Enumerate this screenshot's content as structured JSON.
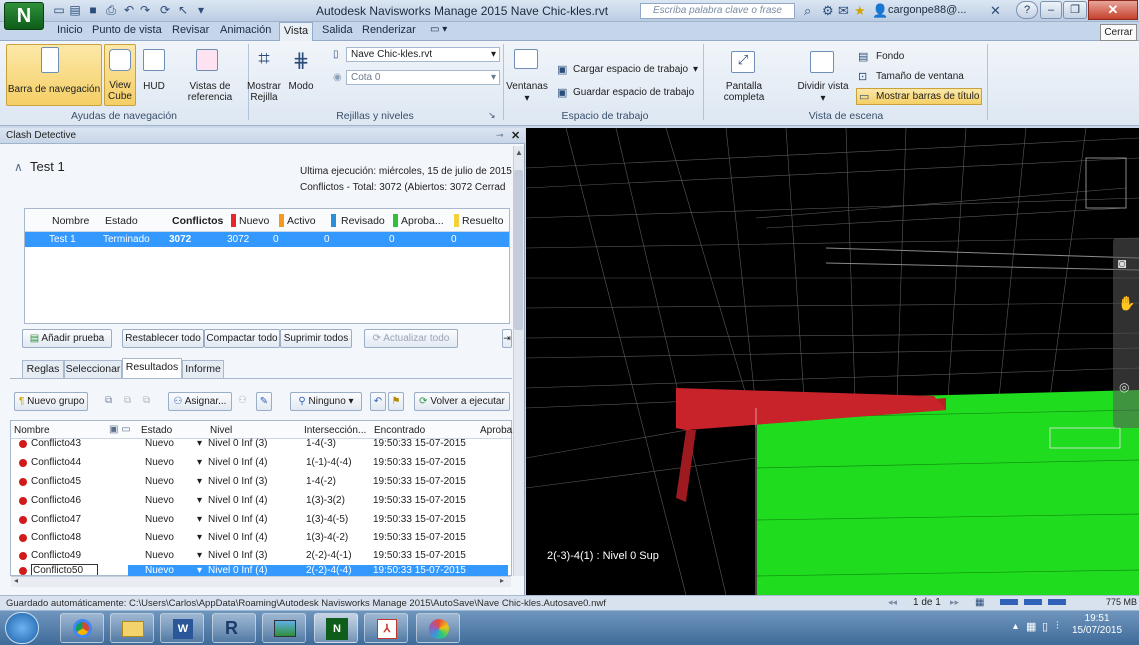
{
  "titlebar": {
    "title": "Autodesk Navisworks Manage 2015   Nave Chic-kles.rvt",
    "search_placeholder": "Escriba palabra clave o frase",
    "user": "cargonpe88@...",
    "close_tooltip": "Cerrar"
  },
  "tabs": [
    "Inicio",
    "Punto de vista",
    "Revisar",
    "Animación",
    "Vista",
    "Salida",
    "Renderizar"
  ],
  "active_tab": "Vista",
  "ribbon": {
    "nav": {
      "barra_label": "Barra de navegación",
      "view_cube": "View Cube",
      "hud": "HUD",
      "vistas_ref": "Vistas de referencia",
      "group_label": "Ayudas de navegación"
    },
    "grids": {
      "mostrar_rejilla": "Mostrar Rejilla",
      "modo": "Modo",
      "model_combo": "Nave Chic-kles.rvt",
      "cota_combo": "Cota 0",
      "group_label": "Rejillas y niveles"
    },
    "workspace": {
      "ventanas": "Ventanas",
      "cargar": "Cargar espacio de trabajo",
      "guardar": "Guardar espacio de trabajo",
      "group_label": "Espacio de trabajo"
    },
    "scene": {
      "pantalla_completa": "Pantalla completa",
      "dividir_vista": "Dividir vista",
      "fondo": "Fondo",
      "tamano": "Tamaño de ventana",
      "barras_titulo": "Mostrar barras de título",
      "group_label": "Vista de escena"
    }
  },
  "clash": {
    "panel_title": "Clash Detective",
    "test_name": "Test 1",
    "last_run": "Última ejecución: miércoles, 15 de julio de 2015 1",
    "summary": "Conflictos - Total: 3072  (Abiertos: 3072  Cerrad",
    "test_table": {
      "headers": [
        "Nombre",
        "Estado",
        "Conflictos",
        "Nuevo",
        "Activo",
        "Revisado",
        "Aproba...",
        "Resuelto"
      ],
      "header_colors": [
        "",
        "",
        "",
        "#e8262a",
        "#f39a1e",
        "#2a8fd6",
        "#2fc13a",
        "#f2d23a"
      ],
      "row": [
        "Test 1",
        "Terminado",
        "3072",
        "3072",
        "0",
        "0",
        "0",
        "0"
      ]
    },
    "buttons": {
      "anadir": "Añadir prueba",
      "restablecer": "Restablecer todo",
      "compactar": "Compactar todo",
      "suprimir": "Suprimir todos",
      "actualizar": "Actualizar todo"
    },
    "subtabs": [
      "Reglas",
      "Seleccionar",
      "Resultados",
      "Informe"
    ],
    "active_subtab": "Resultados",
    "results_toolbar": {
      "nuevo_grupo": "Nuevo grupo",
      "asignar": "Asignar...",
      "ninguno": "Ninguno",
      "volver": "Volver a ejecutar"
    },
    "results_headers": [
      "Nombre",
      "Estado",
      "Nivel",
      "Intersección...",
      "Encontrado",
      "Aproba"
    ],
    "results_rows": [
      {
        "name": "Conflicto43",
        "estado": "Nuevo",
        "nivel": "Nivel 0 Inf (3)",
        "inter": "1-4(-3)",
        "found": "19:50:33 15-07-2015"
      },
      {
        "name": "Conflicto44",
        "estado": "Nuevo",
        "nivel": "Nivel 0 Inf (4)",
        "inter": "1(-1)-4(-4)",
        "found": "19:50:33 15-07-2015"
      },
      {
        "name": "Conflicto45",
        "estado": "Nuevo",
        "nivel": "Nivel 0 Inf (3)",
        "inter": "1-4(-2)",
        "found": "19:50:33 15-07-2015"
      },
      {
        "name": "Conflicto46",
        "estado": "Nuevo",
        "nivel": "Nivel 0 Inf (4)",
        "inter": "1(3)-3(2)",
        "found": "19:50:33 15-07-2015"
      },
      {
        "name": "Conflicto47",
        "estado": "Nuevo",
        "nivel": "Nivel 0 Inf (4)",
        "inter": "1(3)-4(-5)",
        "found": "19:50:33 15-07-2015"
      },
      {
        "name": "Conflicto48",
        "estado": "Nuevo",
        "nivel": "Nivel 0 Inf (4)",
        "inter": "1(3)-4(-2)",
        "found": "19:50:33 15-07-2015"
      },
      {
        "name": "Conflicto49",
        "estado": "Nuevo",
        "nivel": "Nivel 0 Inf (3)",
        "inter": "2(-2)-4(-1)",
        "found": "19:50:33 15-07-2015"
      },
      {
        "name": "Conflicto50",
        "estado": "Nuevo",
        "nivel": "Nivel 0 Inf (4)",
        "inter": "2(-2)-4(-4)",
        "found": "19:50:33 15-07-2015"
      }
    ],
    "selected_row": 7
  },
  "viewport": {
    "grid_label": "2(-3)-4(1) : Nivel 0 Sup"
  },
  "statusbar": {
    "text": "Guardado automáticamente: C:\\Users\\Carlos\\AppData\\Roaming\\Autodesk Navisworks Manage 2015\\AutoSave\\Nave Chic-kles.Autosave0.nwf",
    "page": "1 de 1",
    "memory": "775 MB"
  },
  "taskbar": {
    "time": "19:51",
    "date": "15/07/2015"
  },
  "colors": {
    "clash_red": "#d11a1a",
    "selection_blue": "#3399ff",
    "green_solid": "#1fdc1f",
    "red_beam": "#c8232a"
  }
}
